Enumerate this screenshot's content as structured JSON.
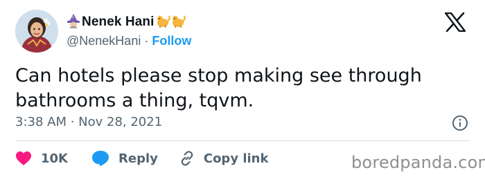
{
  "tweet": {
    "display_name": "Nenek Hani",
    "handle": "@NenekHani",
    "separator": "·",
    "follow_label": "Follow",
    "text": "Can hotels please stop making see through bathrooms a thing, tqvm.",
    "timestamp": "3:38 AM · Nov 28, 2021",
    "like_count": "10K",
    "reply_label": "Reply",
    "copy_link_label": "Copy link"
  },
  "icons": {
    "name_emojis": [
      "witch-emoji-icon",
      "cat-emoji-icon",
      "cat-emoji-icon"
    ],
    "platform_logo": "x-logo-icon",
    "like": "heart-icon",
    "reply": "speech-bubble-icon",
    "copy": "link-icon",
    "info": "info-icon"
  },
  "colors": {
    "like": "#f91880",
    "reply": "#1d9bf0",
    "follow": "#1d9bf0",
    "secondary_text": "#536471"
  },
  "watermark": "boredpanda.com"
}
